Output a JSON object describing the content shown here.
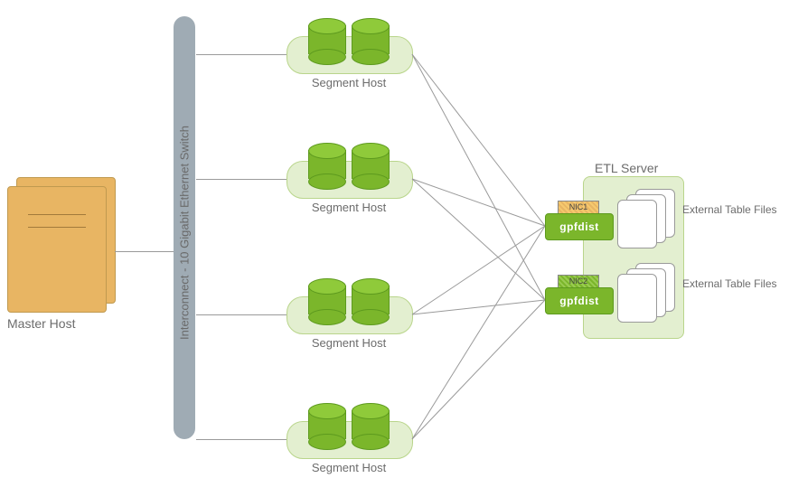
{
  "master": {
    "label": "Master Host"
  },
  "interconnect": {
    "label": "Interconnect  -  10 Gigabit Ethernet Switch"
  },
  "segments": [
    {
      "label": "Segment Host"
    },
    {
      "label": "Segment Host"
    },
    {
      "label": "Segment Host"
    },
    {
      "label": "Segment Host"
    }
  ],
  "etl": {
    "title": "ETL Server",
    "nic1": "NIC1",
    "nic2": "NIC2",
    "gpfdist": "gpfdist",
    "files1_label": "External Table Files",
    "files2_label": "External Table Files"
  },
  "diagram": {
    "type": "architecture",
    "description": "Greenplum-style external table load architecture: one Master Host connects through a 10GbE interconnect switch to four Segment Hosts; each Segment Host connects to two gpfdist processes (bound to NIC1 and NIC2) on an ETL Server that serves External Table Files.",
    "nodes": {
      "master_host": 1,
      "interconnect_switch": 1,
      "segment_hosts": 4,
      "etl_server": 1,
      "gpfdist_instances": 2,
      "nics_on_etl": [
        "NIC1",
        "NIC2"
      ],
      "external_table_file_groups": 2
    },
    "edges": [
      {
        "from": "Master Host",
        "to": "Interconnect Switch"
      },
      {
        "from": "Interconnect Switch",
        "to": "Segment Host 1"
      },
      {
        "from": "Interconnect Switch",
        "to": "Segment Host 2"
      },
      {
        "from": "Interconnect Switch",
        "to": "Segment Host 3"
      },
      {
        "from": "Interconnect Switch",
        "to": "Segment Host 4"
      },
      {
        "from": "Segment Host 1",
        "to": "gpfdist@NIC1"
      },
      {
        "from": "Segment Host 1",
        "to": "gpfdist@NIC2"
      },
      {
        "from": "Segment Host 2",
        "to": "gpfdist@NIC1"
      },
      {
        "from": "Segment Host 2",
        "to": "gpfdist@NIC2"
      },
      {
        "from": "Segment Host 3",
        "to": "gpfdist@NIC1"
      },
      {
        "from": "Segment Host 3",
        "to": "gpfdist@NIC2"
      },
      {
        "from": "Segment Host 4",
        "to": "gpfdist@NIC1"
      },
      {
        "from": "Segment Host 4",
        "to": "gpfdist@NIC2"
      },
      {
        "from": "gpfdist@NIC1",
        "to": "External Table Files (group 1)"
      },
      {
        "from": "gpfdist@NIC2",
        "to": "External Table Files (group 2)"
      }
    ]
  }
}
